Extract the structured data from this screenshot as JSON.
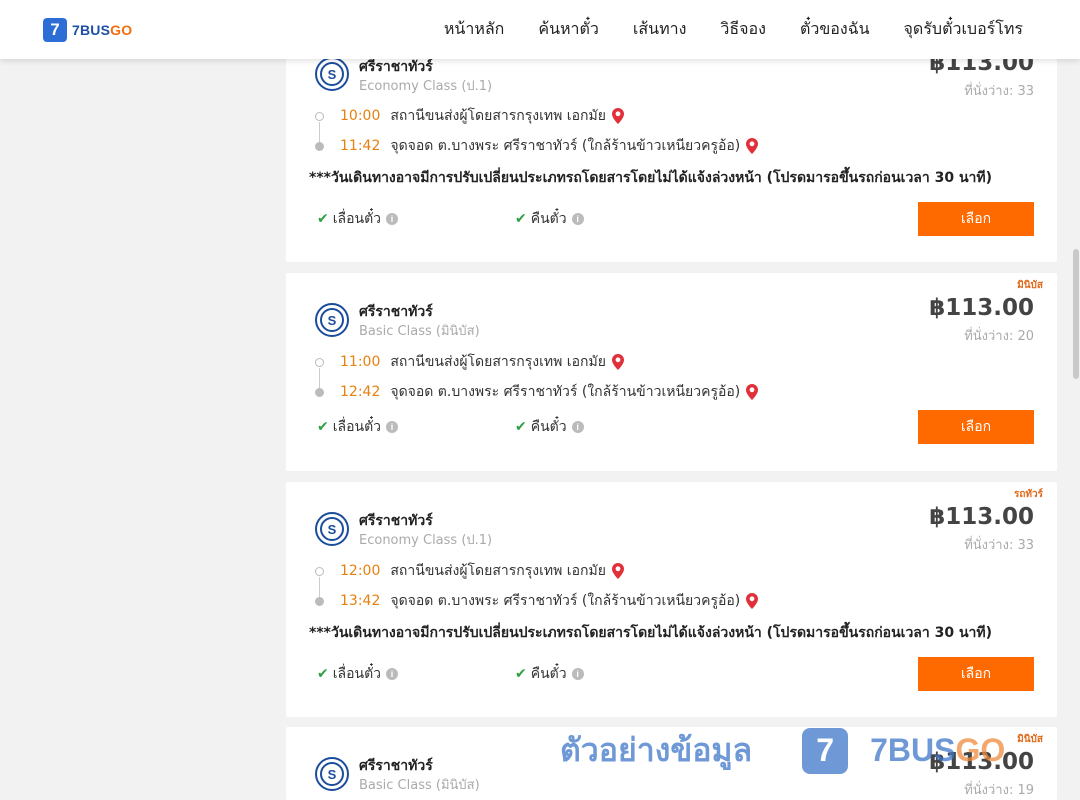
{
  "header": {
    "logo_icon": "7",
    "logo_brand": "7BUS",
    "logo_brand_go": "GO",
    "nav": [
      "หน้าหลัก",
      "ค้นหาตั๋ว",
      "เส้นทาง",
      "วิธีจอง",
      "ตั๋วของฉัน",
      "จุดรับตั๋วเบอร์โทร"
    ]
  },
  "trips": [
    {
      "tag": "",
      "operator_logo": "S",
      "operator": "ศรีราชาทัวร์",
      "class": "Economy Class (ป.1)",
      "price": "฿113.00",
      "seats": "ที่นั่งว่าง: 33",
      "dep_time": "10:00",
      "dep_station": "สถานีขนส่งผู้โดยสารกรุงเทพ เอกมัย",
      "arr_time": "11:42",
      "arr_station": "จุดจอด ต.บางพระ ศรีราชาทัวร์ (ใกล้ร้านข้าวเหนียวครูอ้อ)",
      "notice": "***วันเดินทางอาจมีการปรับเปลี่ยนประเภทรถโดยสารโดยไม่ได้แจ้งล่วงหน้า (โปรดมารอขึ้นรถก่อนเวลา 30 นาที)",
      "feature_reschedule": "เลื่อนตั๋ว",
      "feature_refund": "คืนตั๋ว",
      "select_label": "เลือก"
    },
    {
      "tag": "มินิบัส",
      "operator_logo": "S",
      "operator": "ศรีราชาทัวร์",
      "class": "Basic Class (มินิบัส)",
      "price": "฿113.00",
      "seats": "ที่นั่งว่าง: 20",
      "dep_time": "11:00",
      "dep_station": "สถานีขนส่งผู้โดยสารกรุงเทพ เอกมัย",
      "arr_time": "12:42",
      "arr_station": "จุดจอด ต.บางพระ ศรีราชาทัวร์ (ใกล้ร้านข้าวเหนียวครูอ้อ)",
      "notice": "",
      "feature_reschedule": "เลื่อนตั๋ว",
      "feature_refund": "คืนตั๋ว",
      "select_label": "เลือก"
    },
    {
      "tag": "รถทัวร์",
      "operator_logo": "S",
      "operator": "ศรีราชาทัวร์",
      "class": "Economy Class (ป.1)",
      "price": "฿113.00",
      "seats": "ที่นั่งว่าง: 33",
      "dep_time": "12:00",
      "dep_station": "สถานีขนส่งผู้โดยสารกรุงเทพ เอกมัย",
      "arr_time": "13:42",
      "arr_station": "จุดจอด ต.บางพระ ศรีราชาทัวร์ (ใกล้ร้านข้าวเหนียวครูอ้อ)",
      "notice": "***วันเดินทางอาจมีการปรับเปลี่ยนประเภทรถโดยสารโดยไม่ได้แจ้งล่วงหน้า (โปรดมารอขึ้นรถก่อนเวลา 30 นาที)",
      "feature_reschedule": "เลื่อนตั๋ว",
      "feature_refund": "คืนตั๋ว",
      "select_label": "เลือก"
    },
    {
      "tag": "มินิบัส",
      "operator_logo": "S",
      "operator": "ศรีราชาทัวร์",
      "class": "Basic Class (มินิบัส)",
      "price": "฿113.00",
      "seats": "ที่นั่งว่าง: 19"
    }
  ],
  "info_glyph": "i",
  "check_glyph": "✔",
  "watermark": {
    "text": "ตัวอย่างข้อมูล",
    "icon": "7",
    "brand": "7BUS",
    "brand_go": "GO"
  },
  "colors": {
    "accent_orange": "#ff6a00",
    "time_orange": "#e6810f",
    "brand_blue": "#2c6ed5",
    "check_green": "#2ea043"
  }
}
